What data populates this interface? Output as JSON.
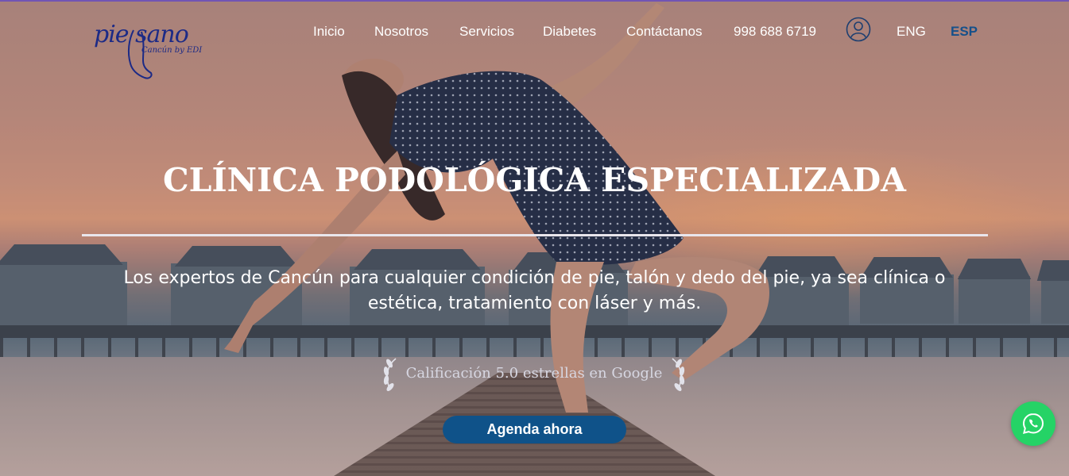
{
  "brand": {
    "logo_main": "pie sano",
    "logo_sub": "Cancún by EDI"
  },
  "nav": {
    "items": [
      {
        "label": "Inicio"
      },
      {
        "label": "Nosotros"
      },
      {
        "label": "Servicios"
      },
      {
        "label": "Diabetes"
      },
      {
        "label": "Contáctanos"
      },
      {
        "label": "998 688 6719"
      }
    ],
    "account_icon": "user-circle-icon",
    "languages": [
      {
        "label": "ENG",
        "active": false
      },
      {
        "label": "ESP",
        "active": true
      }
    ]
  },
  "hero": {
    "title": "CLÍNICA PODOLÓGICA ESPECIALIZADA",
    "subtitle": "Los expertos de Cancún para cualquier condición de pie, talón y dedo del pie, ya sea clínica o estética, tratamiento con láser y más.",
    "rating_text": "Calificación 5.0 estrellas en Google",
    "cta_label": "Agenda ahora"
  },
  "floating": {
    "whatsapp_icon": "whatsapp-icon"
  },
  "colors": {
    "accent": "#0f5289",
    "logo": "#1c2a86",
    "whatsapp": "#25d366",
    "active_lang": "#15508a"
  }
}
